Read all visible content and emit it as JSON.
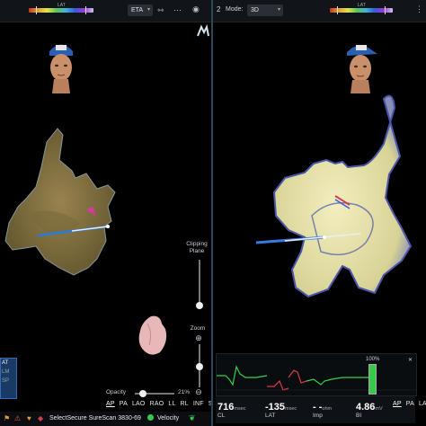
{
  "left": {
    "lat_label": "LAT",
    "eta_label": "ETA",
    "clipping_plane_label": "Clipping Plane",
    "zoom_label": "Zoom",
    "opacity_label": "Opacity",
    "opacity_value": "21%",
    "opacity_level": 0.21,
    "zoom_plus": "⊕",
    "zoom_minus": "⊖",
    "views": [
      "AP",
      "PA",
      "LAO",
      "RAO",
      "LL",
      "RL",
      "INF",
      "SU"
    ],
    "active_view": "AP",
    "lead_label": "SelectSecure SureScan 3830-69",
    "velocity_label": "Velocity",
    "legend_items": [
      "AT",
      "LM",
      "SP"
    ],
    "logo_text": "m"
  },
  "right": {
    "pane_number": "2",
    "mode_label": "Mode:",
    "mode_value": "3D",
    "lat_label": "LAT",
    "views": [
      "AP",
      "PA",
      "LA"
    ],
    "active_view": "AP",
    "percent_label": "100%",
    "metrics": [
      {
        "value": "716",
        "unit": "msec",
        "caption": "CL"
      },
      {
        "value": "-135",
        "unit": "msec",
        "caption": "LAT"
      },
      {
        "value": "- -",
        "unit": "ohm",
        "caption": "Imp"
      },
      {
        "value": "4.86",
        "unit": "mV",
        "caption": "BI"
      }
    ]
  },
  "colors": {
    "background": "#000000",
    "divider": "#2a4a5a",
    "map_left": "#8a7a44",
    "map_right": "#e8e4a8",
    "catheter": "#3a7ae0",
    "ecg_green": "#33d24a",
    "ecg_red": "#d83a4a"
  }
}
